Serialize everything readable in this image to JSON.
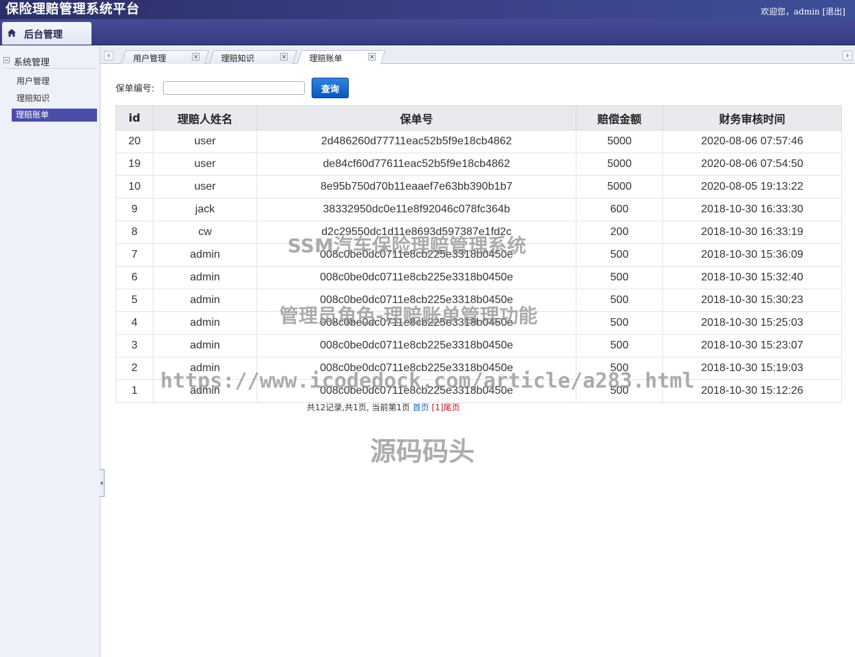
{
  "header": {
    "title": "保险理赔管理系统平台",
    "welcome": "欢迎您，admin",
    "logout": "[退出]"
  },
  "nav": {
    "active_tab": "后台管理",
    "icon": "home-icon"
  },
  "sidebar": {
    "group_label": "系统管理",
    "items": [
      {
        "label": "用户管理",
        "active": false
      },
      {
        "label": "理赔知识",
        "active": false
      },
      {
        "label": "理赔账单",
        "active": true
      }
    ]
  },
  "tabs": [
    {
      "label": "用户管理",
      "active": false
    },
    {
      "label": "理赔知识",
      "active": false
    },
    {
      "label": "理赔账单",
      "active": true
    }
  ],
  "search": {
    "label": "保单编号:",
    "value": "",
    "placeholder": "",
    "button_label": "查询"
  },
  "table": {
    "columns": [
      "id",
      "理赔人姓名",
      "保单号",
      "赔偿金额",
      "财务审核时间"
    ],
    "rows": [
      [
        "20",
        "user",
        "2d486260d77711eac52b5f9e18cb4862",
        "5000",
        "2020-08-06 07:57:46"
      ],
      [
        "19",
        "user",
        "de84cf60d77611eac52b5f9e18cb4862",
        "5000",
        "2020-08-06 07:54:50"
      ],
      [
        "10",
        "user",
        "8e95b750d70b11eaaef7e63bb390b1b7",
        "5000",
        "2020-08-05 19:13:22"
      ],
      [
        "9",
        "jack",
        "38332950dc0e11e8f92046c078fc364b",
        "600",
        "2018-10-30 16:33:30"
      ],
      [
        "8",
        "cw",
        "d2c29550dc1d11e8693d597387e1fd2c",
        "200",
        "2018-10-30 16:33:19"
      ],
      [
        "7",
        "admin",
        "008c0be0dc0711e8cb225e3318b0450e",
        "500",
        "2018-10-30 15:36:09"
      ],
      [
        "6",
        "admin",
        "008c0be0dc0711e8cb225e3318b0450e",
        "500",
        "2018-10-30 15:32:40"
      ],
      [
        "5",
        "admin",
        "008c0be0dc0711e8cb225e3318b0450e",
        "500",
        "2018-10-30 15:30:23"
      ],
      [
        "4",
        "admin",
        "008c0be0dc0711e8cb225e3318b0450e",
        "500",
        "2018-10-30 15:25:03"
      ],
      [
        "3",
        "admin",
        "008c0be0dc0711e8cb225e3318b0450e",
        "500",
        "2018-10-30 15:23:07"
      ],
      [
        "2",
        "admin",
        "008c0be0dc0711e8cb225e3318b0450e",
        "500",
        "2018-10-30 15:19:03"
      ],
      [
        "1",
        "admin",
        "008c0be0dc0711e8cb225e3318b0450e",
        "500",
        "2018-10-30 15:12:26"
      ]
    ]
  },
  "pagination": {
    "summary": "共12记录,共1页, 当前第1页",
    "first": "首页",
    "current": "[1]",
    "last": "尾页"
  },
  "watermarks": [
    "SSM汽车保险理赔管理系统",
    "管理员角色-理赔账单管理功能",
    "https://www.icodedock.com/article/a283.html",
    "源码码头"
  ],
  "colors": {
    "header_bg": "#2a2f66",
    "sidebar_active": "#4b4ea6",
    "button_blue": "#0e56b8",
    "link_blue": "#1467c8",
    "link_red": "#c0151b"
  }
}
